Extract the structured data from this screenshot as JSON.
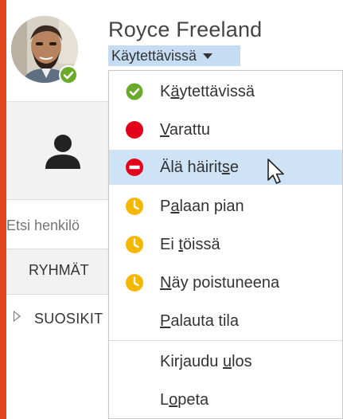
{
  "user": {
    "name": "Royce Freeland",
    "status_label": "Käytettävissä",
    "status_color": "#6aaa2a"
  },
  "search": {
    "placeholder": "Etsi henkilö"
  },
  "tabs": {
    "groups_label": "RYHMÄT"
  },
  "groups": {
    "favorites_label": "SUOSIKIT"
  },
  "status_menu": {
    "items": [
      {
        "label": "Käytettävissä",
        "underline": "ä",
        "prefix": "K",
        "suffix": "ytettävissä",
        "icon": "available-check-icon",
        "color": "#6aaa2a"
      },
      {
        "label": "Varattu",
        "underline": "V",
        "prefix": "",
        "suffix": "arattu",
        "icon": "busy-dot-icon",
        "color": "#e3001b"
      },
      {
        "label": "Älä häiritse",
        "underline": "s",
        "prefix": "Älä häirit",
        "suffix": "e",
        "icon": "do-not-disturb-icon",
        "color": "#e3001b"
      },
      {
        "label": "Palaan pian",
        "underline": "a",
        "prefix": "P",
        "suffix": "laan pian",
        "icon": "clock-icon",
        "color": "#f5b800"
      },
      {
        "label": "Ei töissä",
        "underline": "t",
        "prefix": "Ei ",
        "suffix": "öissä",
        "icon": "clock-icon",
        "color": "#f5b800"
      },
      {
        "label": "Näy poistuneena",
        "underline": "N",
        "prefix": "",
        "suffix": "äy poistuneena",
        "icon": "clock-icon",
        "color": "#f5b800"
      },
      {
        "label": "Palauta tila",
        "underline": "P",
        "prefix": "",
        "suffix": "alauta tila",
        "icon": "",
        "color": ""
      },
      {
        "label": "Kirjaudu ulos",
        "underline": "u",
        "prefix": "Kirjaudu ",
        "suffix": "los",
        "icon": "",
        "color": ""
      },
      {
        "label": "Lopeta",
        "underline": "o",
        "prefix": "L",
        "suffix": "peta",
        "icon": "",
        "color": ""
      }
    ]
  }
}
